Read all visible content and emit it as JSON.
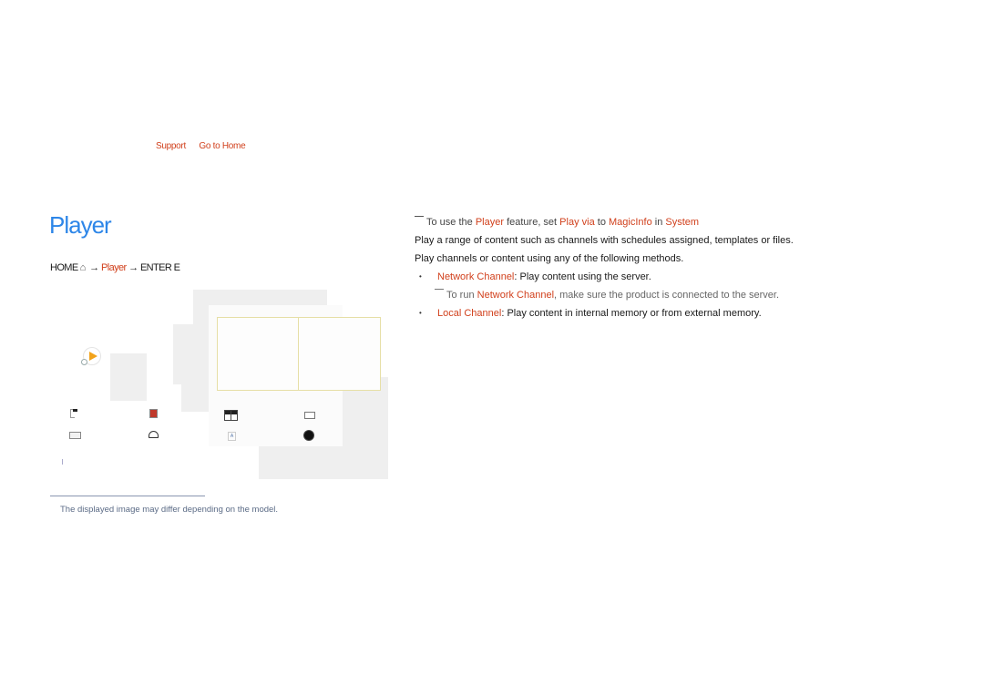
{
  "nav": {
    "links": [
      "Support",
      "Go to Home"
    ]
  },
  "page": {
    "title": "Player",
    "path": {
      "home": "HOME",
      "arrow1": "→",
      "item": "Player",
      "arrow2": "→",
      "action": "ENTER E"
    }
  },
  "diagram": {
    "icons": [
      "flag-icon",
      "lock-icon",
      "grid-icon",
      "display-icon",
      "monitor-icon",
      "headset-icon",
      "text-icon",
      "gear-icon"
    ]
  },
  "footnote": {
    "text": "The displayed image may differ depending on the model."
  },
  "content": {
    "note": {
      "p1": "To use the ",
      "k1": "Player",
      "p2": " feature, set ",
      "k2": "Play via",
      "p3": " to ",
      "k3": "MagicInfo",
      "p4": " in ",
      "k4": "System"
    },
    "intro1": "Play a range of content such as channels with schedules assigned, templates or files.",
    "intro2": "Play channels or content using any of the following methods.",
    "bullets": [
      {
        "term": "Network Channel",
        "desc": ": Play content using the server."
      },
      {
        "term": "Local Channel",
        "desc": ": Play content in internal memory or from external memory."
      }
    ],
    "subnote": {
      "p1": "To run ",
      "k1": "Network Channel",
      "p2": ", make sure the product is connected to the server."
    }
  }
}
